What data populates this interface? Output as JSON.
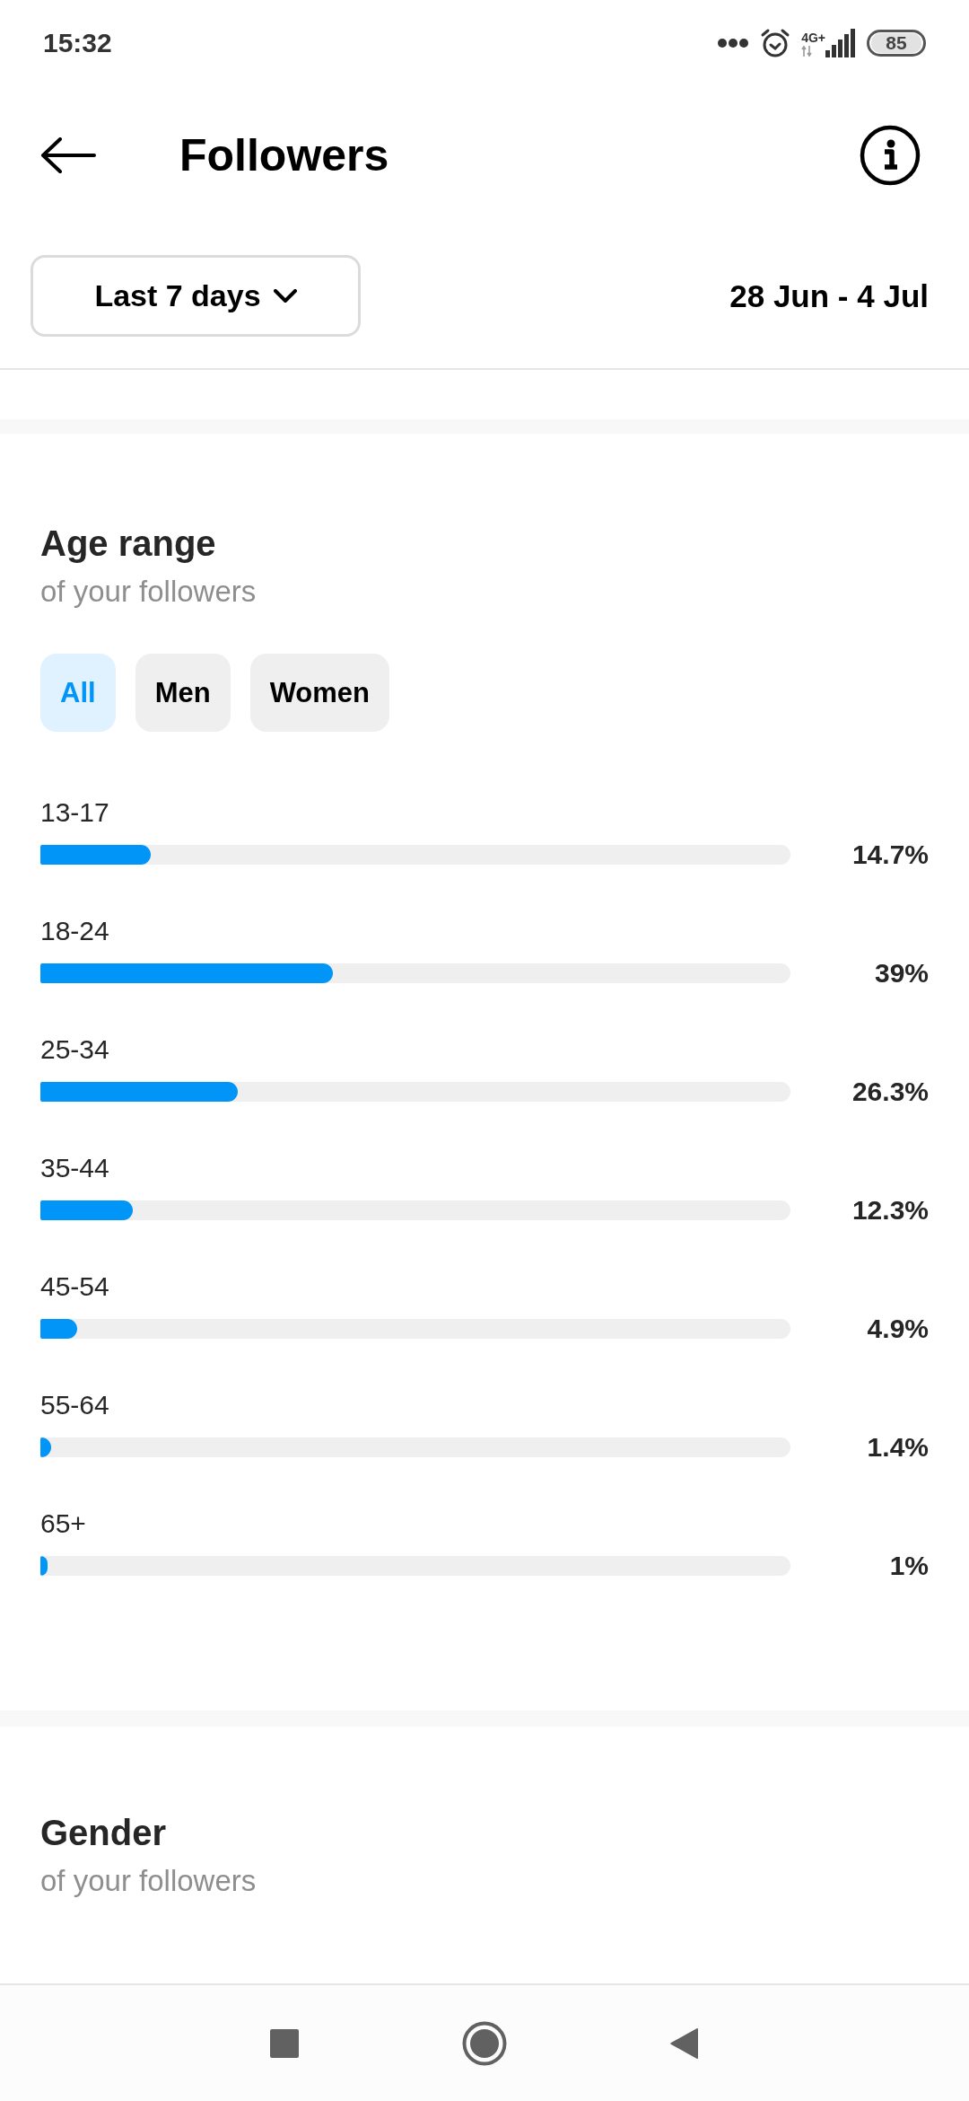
{
  "status_bar": {
    "time": "15:32",
    "network": "4G+",
    "battery": "85"
  },
  "header": {
    "title": "Followers"
  },
  "range": {
    "dropdown": "Last 7 days",
    "dates": "28 Jun - 4 Jul"
  },
  "age_range": {
    "title": "Age range",
    "subtitle": "of your followers",
    "filters": [
      {
        "label": "All",
        "selected": true
      },
      {
        "label": "Men",
        "selected": false
      },
      {
        "label": "Women",
        "selected": false
      }
    ],
    "rows": [
      {
        "label": "13-17",
        "level": 0.147,
        "reading": "14.7%"
      },
      {
        "label": "18-24",
        "level": 0.39,
        "reading": "39%"
      },
      {
        "label": "25-34",
        "level": 0.263,
        "reading": "26.3%"
      },
      {
        "label": "35-44",
        "level": 0.123,
        "reading": "12.3%"
      },
      {
        "label": "45-54",
        "level": 0.049,
        "reading": "4.9%"
      },
      {
        "label": "55-64",
        "level": 0.014,
        "reading": "1.4%"
      },
      {
        "label": "65+",
        "level": 0.01,
        "reading": "1%"
      }
    ]
  },
  "gender": {
    "title": "Gender",
    "subtitle": "of your followers"
  }
}
